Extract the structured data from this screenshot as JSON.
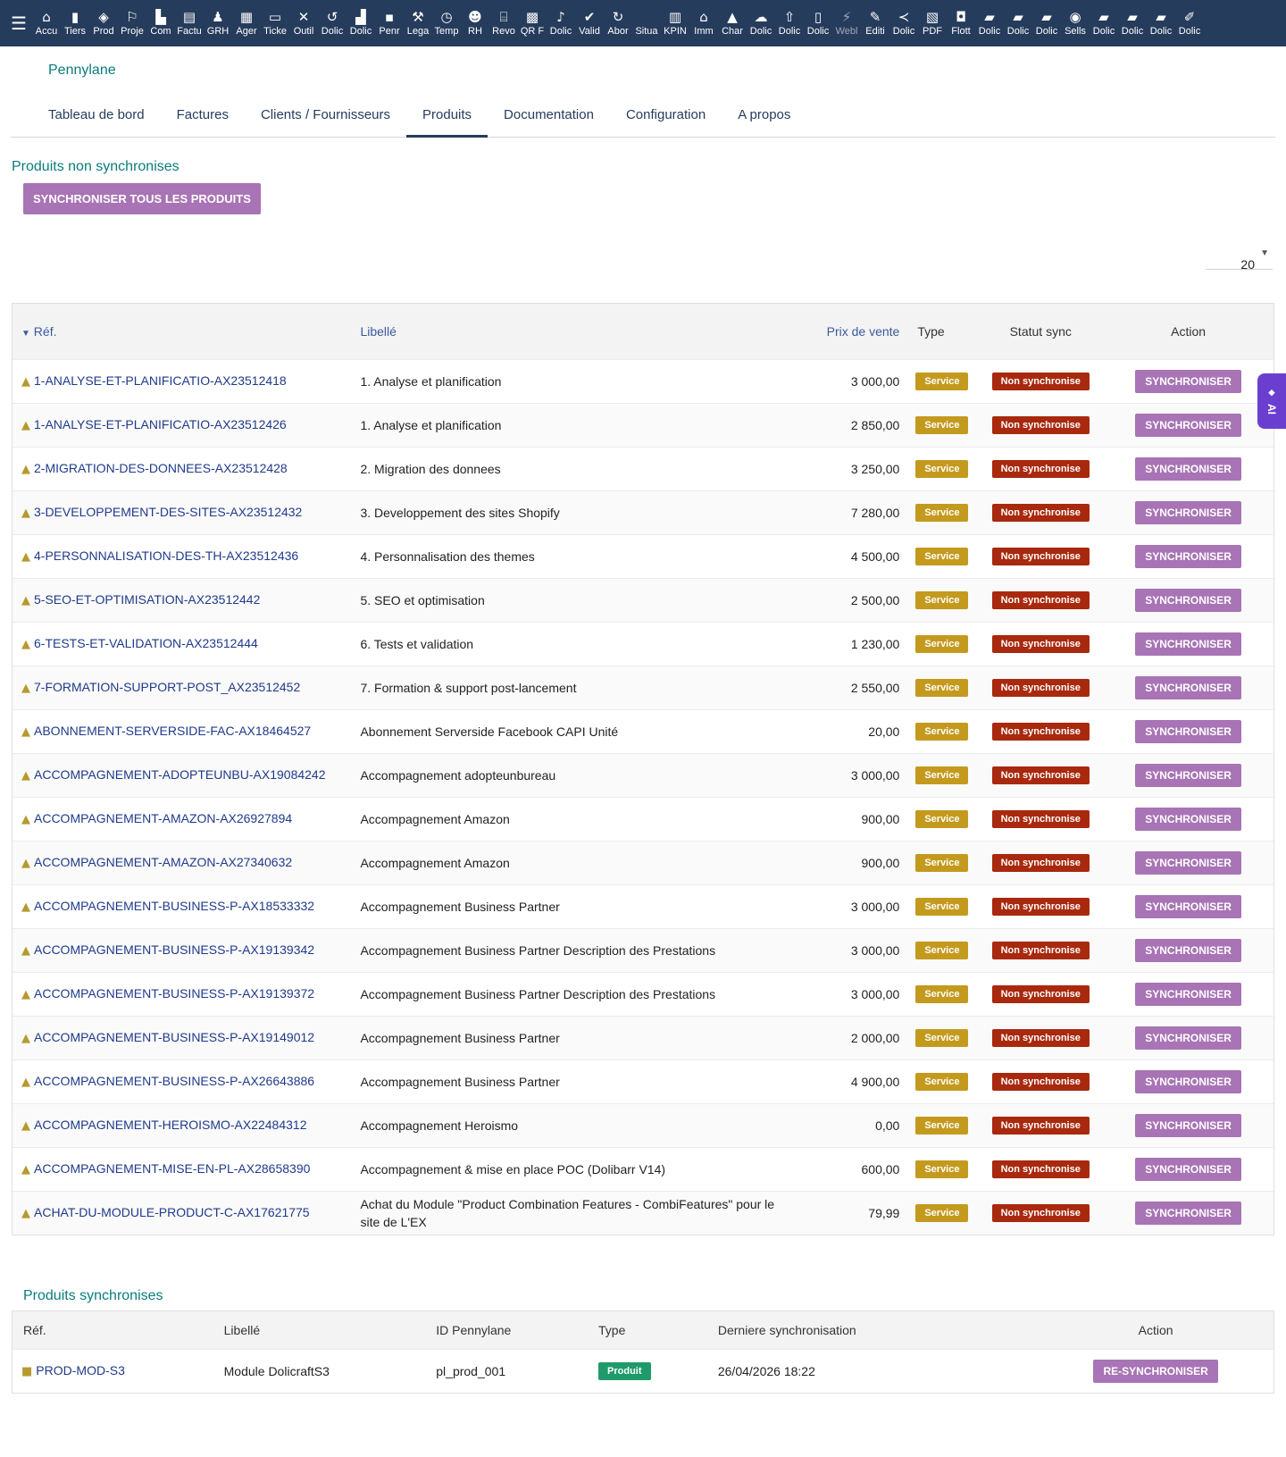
{
  "topbar": {
    "items": [
      {
        "icon": "⌂",
        "label": "Accu"
      },
      {
        "icon": "▮",
        "label": "Tiers"
      },
      {
        "icon": "◈",
        "label": "Prod"
      },
      {
        "icon": "⚐",
        "label": "Proje"
      },
      {
        "icon": "▙",
        "label": "Com"
      },
      {
        "icon": "▤",
        "label": "Factu"
      },
      {
        "icon": "♟",
        "label": "GRH"
      },
      {
        "icon": "▦",
        "label": "Ager"
      },
      {
        "icon": "▭",
        "label": "Ticke"
      },
      {
        "icon": "✕",
        "label": "Outil"
      },
      {
        "icon": "↺",
        "label": "Dolic"
      },
      {
        "icon": "▟",
        "label": "Dolic"
      },
      {
        "icon": "▪",
        "label": "Penr"
      },
      {
        "icon": "⚒",
        "label": "Lega"
      },
      {
        "icon": "◷",
        "label": "Temp"
      },
      {
        "icon": "☻",
        "label": "RH"
      },
      {
        "icon": "⌸",
        "label": "Revo"
      },
      {
        "icon": "▩",
        "label": "QR F"
      },
      {
        "icon": "♪",
        "label": "Dolic"
      },
      {
        "icon": "✔",
        "label": "Valid"
      },
      {
        "icon": "↻",
        "label": "Abor"
      },
      {
        "icon": " ",
        "label": "Situa"
      },
      {
        "icon": "▥",
        "label": "KPIN"
      },
      {
        "icon": "⌂",
        "label": "Imm"
      },
      {
        "icon": "▲",
        "label": "Char"
      },
      {
        "icon": "☁",
        "label": "Dolic"
      },
      {
        "icon": "⇧",
        "label": "Dolic"
      },
      {
        "icon": "▯",
        "label": "Dolic"
      },
      {
        "icon": "⚡",
        "label": "Webl",
        "dim": true
      },
      {
        "icon": "✎",
        "label": "Editi"
      },
      {
        "icon": "≺",
        "label": "Dolic"
      },
      {
        "icon": "▧",
        "label": "PDF"
      },
      {
        "icon": "◘",
        "label": "Flott"
      },
      {
        "icon": "▰",
        "label": "Dolic"
      },
      {
        "icon": "▰",
        "label": "Dolic"
      },
      {
        "icon": "▰",
        "label": "Dolic"
      },
      {
        "icon": "◉",
        "label": "Sells"
      },
      {
        "icon": "▰",
        "label": "Dolic"
      },
      {
        "icon": "▰",
        "label": "Dolic"
      },
      {
        "icon": "▰",
        "label": "Dolic"
      },
      {
        "icon": "✐",
        "label": "Dolic"
      }
    ]
  },
  "brand": "Pennylane",
  "tabs": [
    "Tableau de bord",
    "Factures",
    "Clients / Fournisseurs",
    "Produits",
    "Documentation",
    "Configuration",
    "A propos"
  ],
  "active_tab": "Produits",
  "non_sync": {
    "title": "Produits non synchronises",
    "sync_all_label": "SYNCHRONISER TOUS LES PRODUITS",
    "limit": "20",
    "headers": {
      "ref": "Réf.",
      "libelle": "Libellé",
      "prix": "Prix de vente",
      "type": "Type",
      "statut": "Statut sync",
      "action": "Action"
    },
    "action_label": "SYNCHRONISER",
    "rows": [
      {
        "ref": "1-ANALYSE-ET-PLANIFICATIO-AX23512418",
        "libelle": "1. Analyse et planification",
        "prix": "3 000,00",
        "type": "Service",
        "statut": "Non synchronise"
      },
      {
        "ref": "1-ANALYSE-ET-PLANIFICATIO-AX23512426",
        "libelle": "1. Analyse et planification",
        "prix": "2 850,00",
        "type": "Service",
        "statut": "Non synchronise"
      },
      {
        "ref": "2-MIGRATION-DES-DONNEES-AX23512428",
        "libelle": "2. Migration des donnees",
        "prix": "3 250,00",
        "type": "Service",
        "statut": "Non synchronise"
      },
      {
        "ref": "3-DEVELOPPEMENT-DES-SITES-AX23512432",
        "libelle": "3. Developpement des sites Shopify",
        "prix": "7 280,00",
        "type": "Service",
        "statut": "Non synchronise"
      },
      {
        "ref": "4-PERSONNALISATION-DES-TH-AX23512436",
        "libelle": "4. Personnalisation des themes",
        "prix": "4 500,00",
        "type": "Service",
        "statut": "Non synchronise"
      },
      {
        "ref": "5-SEO-ET-OPTIMISATION-AX23512442",
        "libelle": "5. SEO et optimisation",
        "prix": "2 500,00",
        "type": "Service",
        "statut": "Non synchronise"
      },
      {
        "ref": "6-TESTS-ET-VALIDATION-AX23512444",
        "libelle": "6. Tests et validation",
        "prix": "1 230,00",
        "type": "Service",
        "statut": "Non synchronise"
      },
      {
        "ref": "7-FORMATION-SUPPORT-POST_AX23512452",
        "libelle": "7. Formation & support post-lancement",
        "prix": "2 550,00",
        "type": "Service",
        "statut": "Non synchronise"
      },
      {
        "ref": "ABONNEMENT-SERVERSIDE-FAC-AX18464527",
        "libelle": "Abonnement Serverside Facebook CAPI Unité",
        "prix": "20,00",
        "type": "Service",
        "statut": "Non synchronise"
      },
      {
        "ref": "ACCOMPAGNEMENT-ADOPTEUNBU-AX19084242",
        "libelle": "Accompagnement adopteunbureau",
        "prix": "3 000,00",
        "type": "Service",
        "statut": "Non synchronise"
      },
      {
        "ref": "ACCOMPAGNEMENT-AMAZON-AX26927894",
        "libelle": "Accompagnement Amazon",
        "prix": "900,00",
        "type": "Service",
        "statut": "Non synchronise"
      },
      {
        "ref": "ACCOMPAGNEMENT-AMAZON-AX27340632",
        "libelle": "Accompagnement Amazon",
        "prix": "900,00",
        "type": "Service",
        "statut": "Non synchronise"
      },
      {
        "ref": "ACCOMPAGNEMENT-BUSINESS-P-AX18533332",
        "libelle": "Accompagnement Business Partner",
        "prix": "3 000,00",
        "type": "Service",
        "statut": "Non synchronise"
      },
      {
        "ref": "ACCOMPAGNEMENT-BUSINESS-P-AX19139342",
        "libelle": "Accompagnement Business Partner Description des Prestations",
        "prix": "3 000,00",
        "type": "Service",
        "statut": "Non synchronise"
      },
      {
        "ref": "ACCOMPAGNEMENT-BUSINESS-P-AX19139372",
        "libelle": "Accompagnement Business Partner Description des Prestations",
        "prix": "3 000,00",
        "type": "Service",
        "statut": "Non synchronise"
      },
      {
        "ref": "ACCOMPAGNEMENT-BUSINESS-P-AX19149012",
        "libelle": "Accompagnement Business Partner",
        "prix": "2 000,00",
        "type": "Service",
        "statut": "Non synchronise"
      },
      {
        "ref": "ACCOMPAGNEMENT-BUSINESS-P-AX26643886",
        "libelle": "Accompagnement Business Partner",
        "prix": "4 900,00",
        "type": "Service",
        "statut": "Non synchronise"
      },
      {
        "ref": "ACCOMPAGNEMENT-HEROISMO-AX22484312",
        "libelle": "Accompagnement Heroismo",
        "prix": "0,00",
        "type": "Service",
        "statut": "Non synchronise"
      },
      {
        "ref": "ACCOMPAGNEMENT-MISE-EN-PL-AX28658390",
        "libelle": "Accompagnement & mise en place POC (Dolibarr V14)",
        "prix": "600,00",
        "type": "Service",
        "statut": "Non synchronise"
      },
      {
        "ref": "ACHAT-DU-MODULE-PRODUCT-C-AX17621775",
        "libelle": "Achat du Module \"Product Combination Features - CombiFeatures\" pour le site de L'EX",
        "prix": "79,99",
        "type": "Service",
        "statut": "Non synchronise"
      }
    ]
  },
  "sync": {
    "title": "Produits synchronises",
    "headers": {
      "ref": "Réf.",
      "libelle": "Libellé",
      "id": "ID Pennylane",
      "type": "Type",
      "date": "Derniere synchronisation",
      "action": "Action"
    },
    "action_label": "RE-SYNCHRONISER",
    "rows": [
      {
        "ref": "PROD-MOD-S3",
        "libelle": "Module DolicraftS3",
        "id": "pl_prod_001",
        "type": "Produit",
        "date": "26/04/2026 18:22"
      }
    ]
  },
  "ai_tab": "AI",
  "colors": {
    "topbar": "#263c5c",
    "accent": "#a874b5",
    "teal": "#0a7c7c",
    "service": "#c49a1e",
    "nonsync": "#a8290e",
    "produit": "#1f9a6a"
  }
}
